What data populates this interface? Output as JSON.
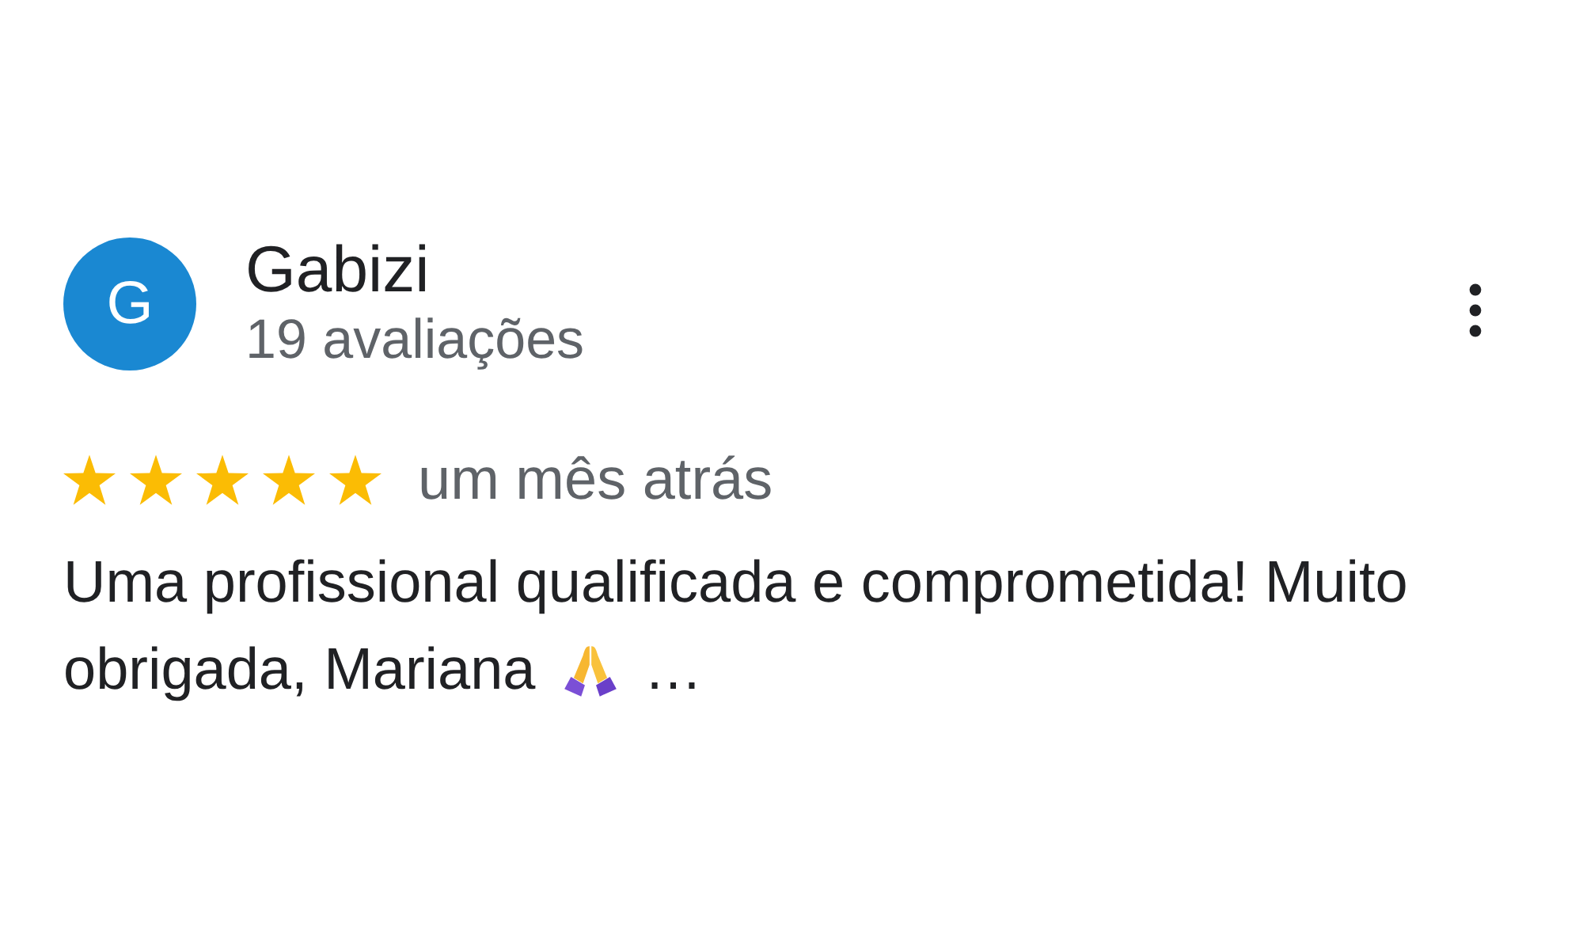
{
  "review": {
    "author": {
      "initial": "G",
      "name": "Gabizi",
      "review_count": "19 avaliações"
    },
    "stars": 5,
    "time": "um mês atrás",
    "text": "Uma profissional qualificada e comprometida! Muito obrigada, Mariana",
    "ellipsis": "…"
  }
}
